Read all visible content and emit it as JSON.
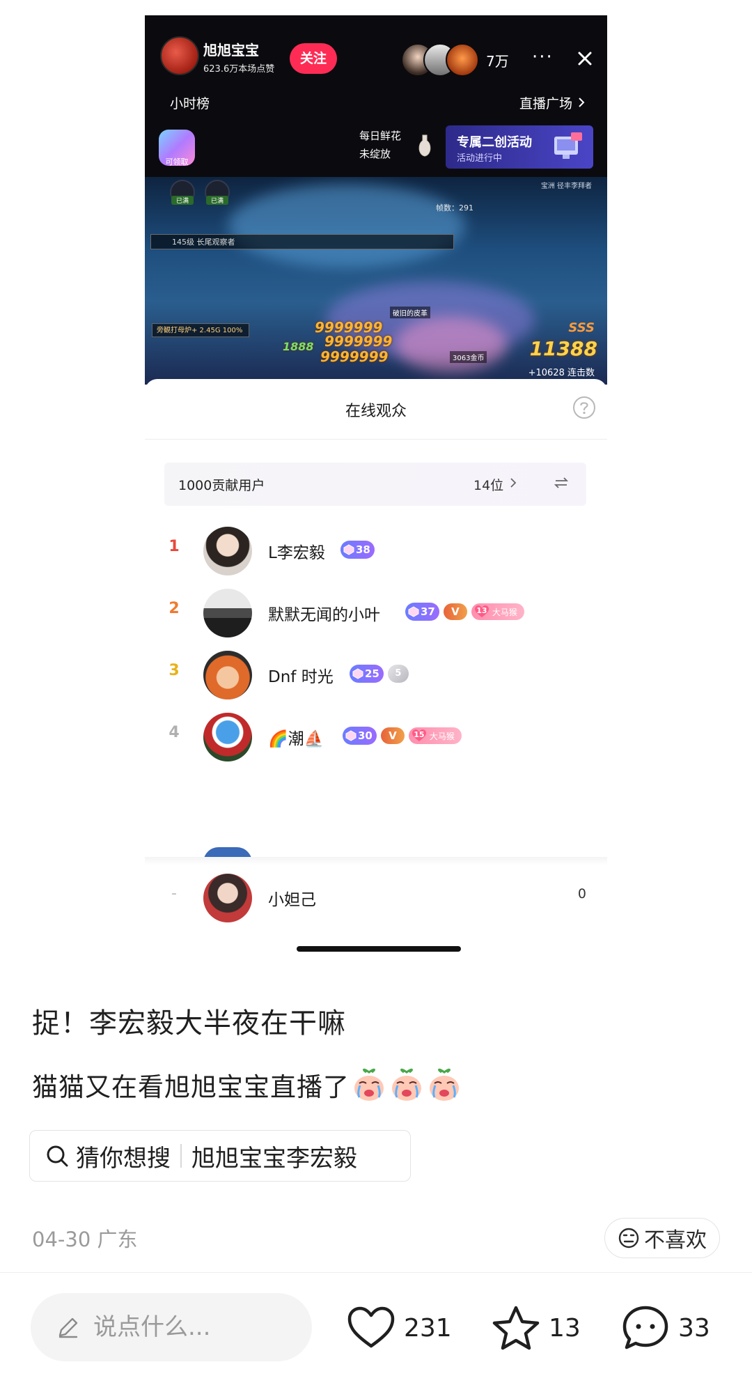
{
  "live": {
    "host_name": "旭旭宝宝",
    "host_likes": "623.6万本场点赞",
    "follow_label": "关注",
    "viewer_count": "7万",
    "more_label": "···",
    "hour_rank_label": "小时榜",
    "plaza_label": "直播广场",
    "gift_label": "可领取",
    "flower_line1": "每日鲜花",
    "flower_line2": "未绽放",
    "activity_title": "专属二创活动",
    "activity_sub": "活动进行中",
    "game": {
      "boss_label": "145级 长尾观察者",
      "skill_label": "旁観打母炉+ 2.45G 100%",
      "buff1": "已满",
      "buff2": "已满",
      "kill_count": "帧数：291",
      "top_tag": "宝洲  径丰李拜者",
      "equip_label": "破旧的皮革",
      "gold_label": "3063金币",
      "combo_rank": "SSS",
      "combo_num": "11388",
      "score_line": "+10628 连击数",
      "dmg1": "9999999",
      "dmg2": "9999999",
      "dmg3": "9999999",
      "dmg4": "1888"
    }
  },
  "sheet": {
    "title": "在线观众",
    "contrib_label": "1000贡献用户",
    "contrib_count": "14位",
    "viewers": [
      {
        "rank": "1",
        "name": "L李宏毅",
        "level": "38"
      },
      {
        "rank": "2",
        "name": "默默无闻的小叶",
        "level": "37",
        "vip": "V",
        "fan_level": "13",
        "fan_name": "大马猴"
      },
      {
        "rank": "3",
        "name": "Dnf  时光",
        "level": "25",
        "silver": "5"
      },
      {
        "rank": "4",
        "name": "🌈潮⛵",
        "level": "30",
        "vip": "V",
        "fan_level": "15",
        "fan_name": "大马猴"
      }
    ],
    "me": {
      "rank": "-",
      "name": "小妲己",
      "score": "0"
    }
  },
  "post": {
    "title": "捉！李宏毅大半夜在干嘛",
    "body": "猫猫又在看旭旭宝宝直播了",
    "search_label": "猜你想搜",
    "search_query": "旭旭宝宝李宏毅",
    "date_location": "04-30 广东",
    "dislike_label": "不喜欢"
  },
  "bottom_bar": {
    "comment_placeholder": "说点什么...",
    "likes": "231",
    "favorites": "13",
    "comments": "33"
  },
  "colors": {
    "accent": "#fe2c55",
    "rank1": "#e8483c",
    "rank2": "#f07a2e",
    "rank3": "#e8b21c",
    "rank_other": "#b0b0b0"
  },
  "icons": [
    "close-icon",
    "chevron-right-icon",
    "help-icon",
    "swap-icon",
    "search-icon",
    "pencil-icon",
    "heart-icon",
    "star-icon",
    "comment-icon",
    "dislike-face-icon",
    "vase-icon",
    "crying-peach-emoji"
  ]
}
